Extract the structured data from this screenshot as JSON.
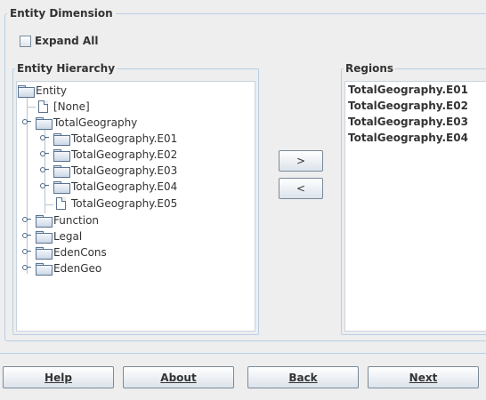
{
  "group": {
    "title": "Entity Dimension"
  },
  "expand_all": {
    "label": "Expand All",
    "checked": false
  },
  "hierarchy": {
    "title": "Entity Hierarchy",
    "nodes": [
      {
        "label": "Entity",
        "icon": "folder-icon"
      },
      {
        "label": "[None]",
        "icon": "document-icon"
      },
      {
        "label": "TotalGeography",
        "icon": "folder-icon"
      },
      {
        "label": "TotalGeography.E01",
        "icon": "folder-icon"
      },
      {
        "label": "TotalGeography.E02",
        "icon": "folder-icon"
      },
      {
        "label": "TotalGeography.E03",
        "icon": "folder-icon"
      },
      {
        "label": "TotalGeography.E04",
        "icon": "folder-icon"
      },
      {
        "label": "TotalGeography.E05",
        "icon": "document-icon"
      },
      {
        "label": "Function",
        "icon": "folder-icon"
      },
      {
        "label": "Legal",
        "icon": "folder-icon"
      },
      {
        "label": "EdenCons",
        "icon": "folder-icon"
      },
      {
        "label": "EdenGeo",
        "icon": "folder-icon"
      }
    ]
  },
  "move_buttons": {
    "add": ">",
    "remove": "<"
  },
  "regions": {
    "title": "Regions",
    "items": [
      "TotalGeography.E01",
      "TotalGeography.E02",
      "TotalGeography.E03",
      "TotalGeography.E04"
    ]
  },
  "footer": {
    "help": "Help",
    "about": "About",
    "back": "Back",
    "next": "Next"
  }
}
